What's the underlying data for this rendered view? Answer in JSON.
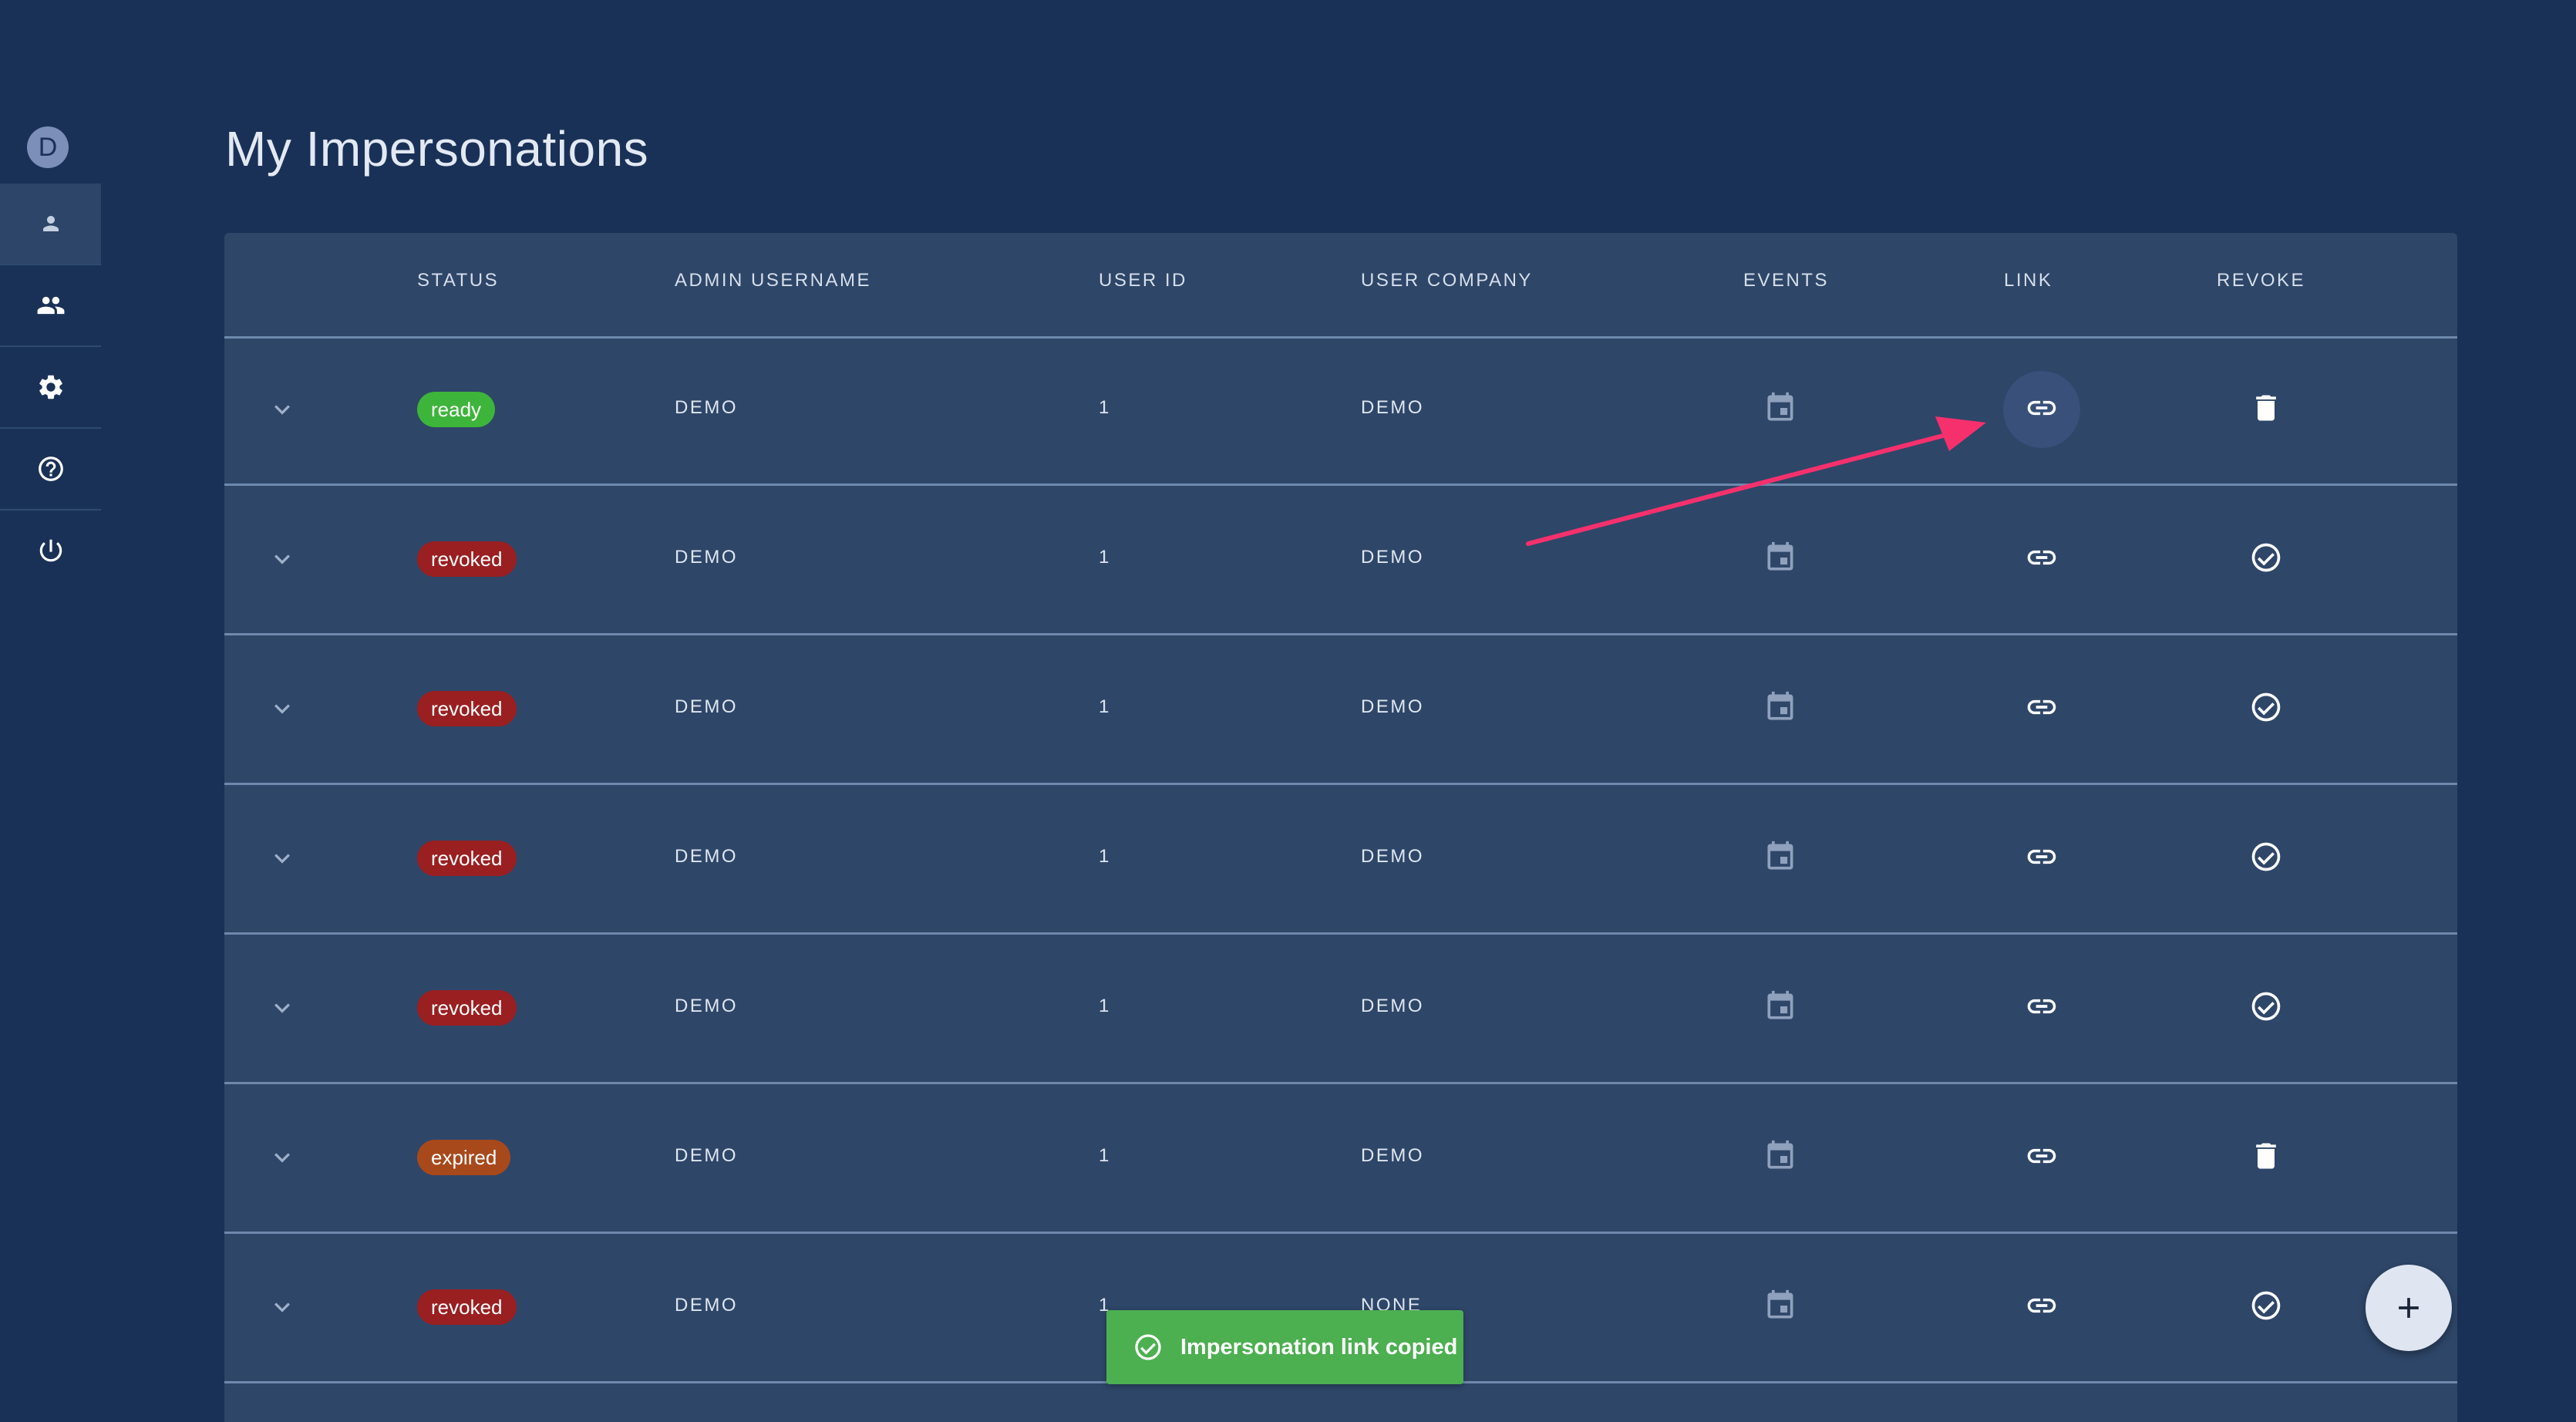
{
  "sidebar": {
    "avatar_letter": "D",
    "items": [
      {
        "icon": "person-icon",
        "active": true
      },
      {
        "icon": "group-icon",
        "active": false
      },
      {
        "icon": "gear-icon",
        "active": false
      },
      {
        "icon": "help-icon",
        "active": false
      },
      {
        "icon": "power-icon",
        "active": false
      }
    ]
  },
  "page": {
    "title": "My Impersonations"
  },
  "table": {
    "columns": [
      "STATUS",
      "ADMIN USERNAME",
      "USER ID",
      "USER COMPANY",
      "EVENTS",
      "LINK",
      "REVOKE"
    ],
    "rows": [
      {
        "status": "ready",
        "admin_username": "DEMO",
        "user_id": "1",
        "user_company": "DEMO",
        "revoke_icon": "trash-icon"
      },
      {
        "status": "revoked",
        "admin_username": "DEMO",
        "user_id": "1",
        "user_company": "DEMO",
        "revoke_icon": "check-circle-icon"
      },
      {
        "status": "revoked",
        "admin_username": "DEMO",
        "user_id": "1",
        "user_company": "DEMO",
        "revoke_icon": "check-circle-icon"
      },
      {
        "status": "revoked",
        "admin_username": "DEMO",
        "user_id": "1",
        "user_company": "DEMO",
        "revoke_icon": "check-circle-icon"
      },
      {
        "status": "revoked",
        "admin_username": "DEMO",
        "user_id": "1",
        "user_company": "DEMO",
        "revoke_icon": "check-circle-icon"
      },
      {
        "status": "expired",
        "admin_username": "DEMO",
        "user_id": "1",
        "user_company": "DEMO",
        "revoke_icon": "trash-icon"
      },
      {
        "status": "revoked",
        "admin_username": "DEMO",
        "user_id": "1",
        "user_company": "NONE",
        "revoke_icon": "check-circle-icon"
      }
    ]
  },
  "toast": {
    "message": "Impersonation link copied",
    "icon": "check-circle-icon"
  },
  "fab": {
    "icon": "add-icon"
  },
  "annotation": {
    "type": "arrow",
    "color": "#f5306d"
  },
  "colors": {
    "background": "#1a3157",
    "table": "#2e4668",
    "status_ready": "#3db53a",
    "status_revoked": "#9a1f21",
    "status_expired": "#a8491c",
    "toast": "#4caf50"
  }
}
